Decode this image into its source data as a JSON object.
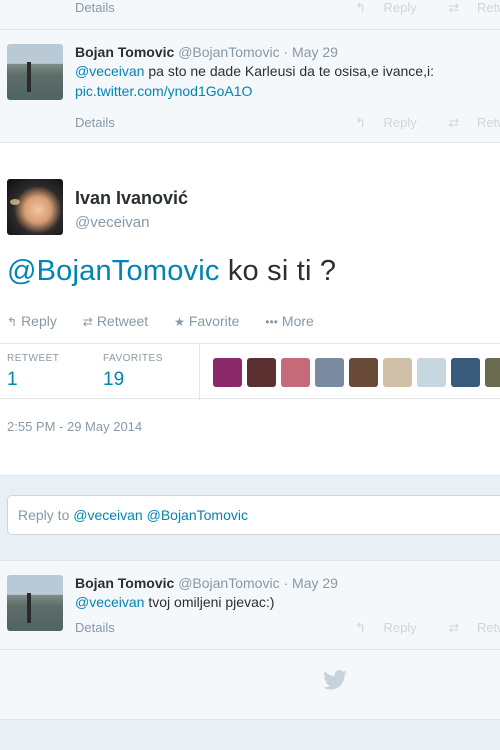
{
  "top_fragment": {
    "details": "Details",
    "reply": "Reply",
    "retweet": "Retweet"
  },
  "reply_tweet_1": {
    "fullname": "Bojan Tomovic",
    "username": "@BojanTomovic",
    "dot": "·",
    "time": "May 29",
    "mention": "@veceivan",
    "text": " pa sto ne dade Karleusi da te osisa,e ivance,i:",
    "link": "pic.twitter.com/ynod1GoA1O",
    "details": "Details",
    "reply": "Reply",
    "retweet": "Retweet"
  },
  "main_tweet": {
    "fullname": "Ivan Ivanović",
    "username": "@veceivan",
    "mention": "@BojanTomovic",
    "text": " ko si ti ?",
    "actions": {
      "reply": "Reply",
      "retweet": "Retweet",
      "favorite": "Favorite",
      "more": "More"
    },
    "stats": {
      "retweets_label": "RETWEET",
      "retweets_value": "1",
      "favorites_label": "FAVORITES",
      "favorites_value": "19"
    },
    "favoriter_avatar_colors": [
      "#8a2a6a",
      "#5a3030",
      "#c46a78",
      "#7a8aa0",
      "#6a4a38",
      "#d0c0a8",
      "#c7d7e0",
      "#3a5a7a",
      "#6a6a50"
    ],
    "datetime": "2:55 PM - 29 May 2014"
  },
  "reply_box": {
    "prefix": "Reply to ",
    "mention1": "@veceivan",
    "mention2": "@BojanTomovic"
  },
  "reply_tweet_2": {
    "fullname": "Bojan Tomovic",
    "username": "@BojanTomovic",
    "dot": "·",
    "time": "May 29",
    "mention": "@veceivan",
    "text": " tvoj omiljeni pjevac:)",
    "details": "Details",
    "reply": "Reply",
    "retweet": "Retweet"
  },
  "colors": {
    "link": "#0084b4",
    "muted": "#8899a6",
    "background": "#e8f0f5"
  }
}
